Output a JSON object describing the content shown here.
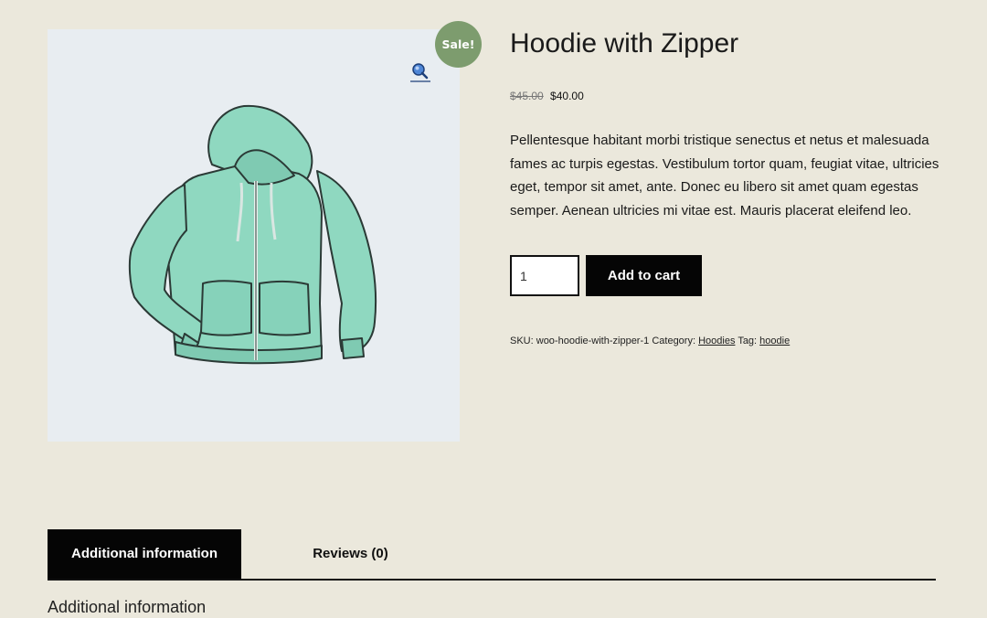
{
  "product": {
    "title": "Hoodie with Zipper",
    "sale_badge": "Sale!",
    "price_old": "$45.00",
    "price_new": "$40.00",
    "description": "Pellentesque habitant morbi tristique senectus et netus et malesuada fames ac turpis egestas. Vestibulum tortor quam, feugiat vitae, ultricies eget, tempor sit amet, ante. Donec eu libero sit amet quam egestas semper. Aenean ultricies mi vitae est. Mauris placerat eleifend leo.",
    "quantity": "1",
    "add_to_cart_label": "Add to cart",
    "image_icon": "hoodie-image",
    "zoom_icon": "magnifier-icon"
  },
  "meta": {
    "sku_label": "SKU:",
    "sku_value": "woo-hoodie-with-zipper-1",
    "category_label": "Category:",
    "category_value": "Hoodies",
    "tag_label": "Tag:",
    "tag_value": "hoodie"
  },
  "tabs": [
    {
      "label": "Additional information",
      "active": true
    },
    {
      "label": "Reviews (0)",
      "active": false
    }
  ],
  "panel": {
    "heading": "Additional information"
  },
  "colors": {
    "page_background": "#ebe8dc",
    "sale_badge": "#7d9c6e",
    "button": "#050505",
    "hoodie": "#8fd8c0"
  }
}
